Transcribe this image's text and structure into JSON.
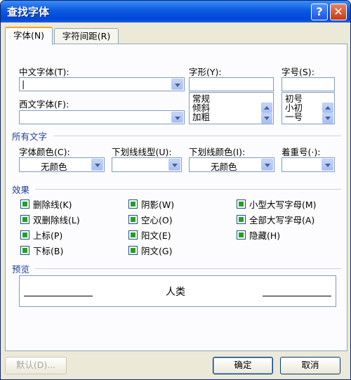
{
  "window": {
    "title": "查找字体",
    "help_label": "?",
    "close_label": "✕"
  },
  "tabs": [
    {
      "label": "字体(N)",
      "active": true
    },
    {
      "label": "字符间距(R)",
      "active": false
    }
  ],
  "font": {
    "chinese_font_label": "中文字体(T):",
    "chinese_font_value": "|",
    "western_font_label": "西文字体(F):",
    "western_font_value": "",
    "style_label": "字形(Y):",
    "style_value": "",
    "style_options": [
      "常规",
      "倾斜",
      "加粗"
    ],
    "size_label": "字号(S):",
    "size_value": "",
    "size_options": [
      "初号",
      "小初",
      "一号"
    ]
  },
  "all_text": {
    "section_title": "所有文字",
    "font_color_label": "字体颜色(C):",
    "font_color_value": "无颜色",
    "underline_type_label": "下划线线型(U):",
    "underline_type_value": "",
    "underline_color_label": "下划线颜色(I):",
    "underline_color_value": "无颜色",
    "emphasis_label": "着重号(·):",
    "emphasis_value": ""
  },
  "effects": {
    "section_title": "效果",
    "col1": [
      "删除线(K)",
      "双删除线(L)",
      "上标(P)",
      "下标(B)"
    ],
    "col2": [
      "阴影(W)",
      "空心(O)",
      "阳文(E)",
      "阴文(G)"
    ],
    "col3": [
      "小型大写字母(M)",
      "全部大写字母(A)",
      "隐藏(H)"
    ]
  },
  "preview": {
    "section_title": "预览",
    "sample_text": "人类"
  },
  "buttons": {
    "default_label": "默认(D)...",
    "ok_label": "确定",
    "cancel_label": "取消"
  },
  "colors": {
    "titlebar": "#0a5ae0",
    "section_text": "#1c3f94",
    "checkbox_fill": "#21a121",
    "dialog_bg": "#ece9d8"
  }
}
